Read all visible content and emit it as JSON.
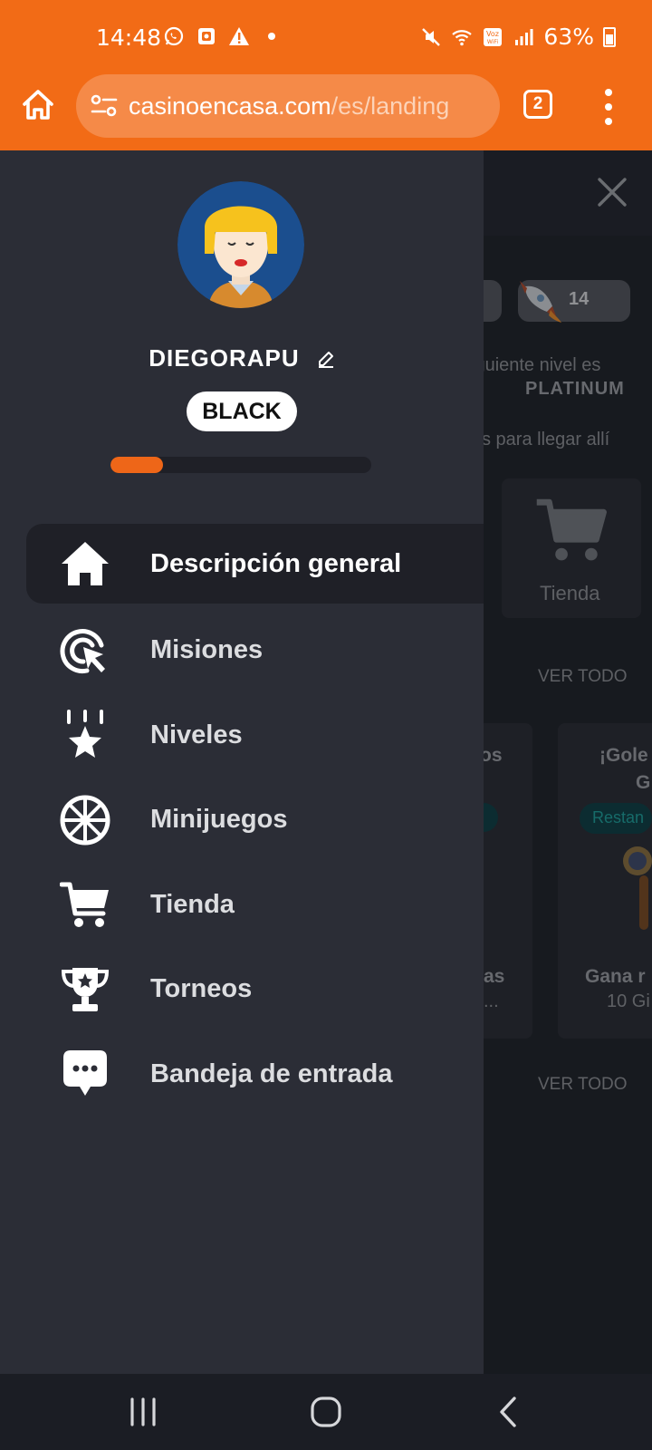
{
  "status_bar": {
    "time": "14:48",
    "battery": "63%",
    "icons": [
      "whatsapp-icon",
      "photo-icon",
      "warning-icon",
      "dot-icon",
      "mute-icon",
      "wifi-icon",
      "volte-icon",
      "signal-icon",
      "battery-icon"
    ]
  },
  "browser": {
    "url_domain": "casinoencasa.com",
    "url_path": "/es/landing",
    "tab_count": "2"
  },
  "profile": {
    "username": "DIEGORAPU",
    "level": "BLACK",
    "progress": 0.2
  },
  "nav": {
    "items": [
      {
        "label": "Descripción general",
        "icon": "home-icon",
        "active": true
      },
      {
        "label": "Misiones",
        "icon": "target-cursor-icon"
      },
      {
        "label": "Niveles",
        "icon": "star-icon"
      },
      {
        "label": "Minijuegos",
        "icon": "wheel-icon"
      },
      {
        "label": "Tienda",
        "icon": "cart-icon"
      },
      {
        "label": "Torneos",
        "icon": "trophy-icon"
      },
      {
        "label": "Bandeja de entrada",
        "icon": "chat-icon"
      }
    ]
  },
  "background": {
    "rocket_count": "14",
    "next_level_text": "iguiente nivel es",
    "next_level_name": "PLATINUM",
    "reach_text": "s para llegar allí",
    "shop_label": "Tienda",
    "see_all_1": "VER TODO",
    "see_all_2": "VER TODO",
    "card1_title_frag": "os",
    "card1_bottom": "as",
    "card1_sub": "...",
    "card2_title_a": "¡Gole",
    "card2_title_b": "G",
    "card2_badge": "Restan",
    "card2_bottom": "Gana r",
    "card2_sub": "10 Gi"
  },
  "colors": {
    "brand_orange": "#f26b16",
    "drawer_bg": "#2b2d36",
    "active_item_bg": "#1f2027",
    "progress": "#ee6618"
  }
}
